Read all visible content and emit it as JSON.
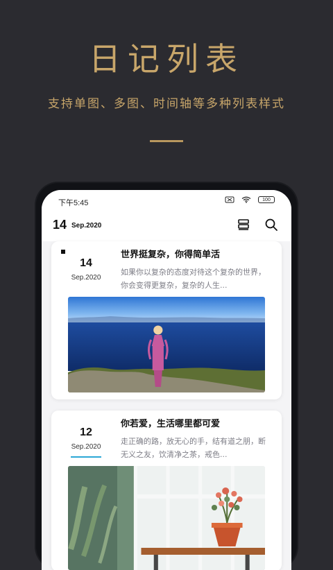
{
  "hero": {
    "title": "日记列表",
    "subtitle": "支持单图、多图、时间轴等多种列表样式"
  },
  "status_bar": {
    "time": "下午5:45",
    "battery": "100",
    "icons": [
      "sim-off-icon",
      "wifi-icon",
      "battery-icon"
    ]
  },
  "header": {
    "day": "14",
    "month_year": "Sep.2020",
    "icons": [
      "layout-icon",
      "search-icon"
    ]
  },
  "entries": [
    {
      "day": "14",
      "month_year": "Sep.2020",
      "title": "世界挺复杂，你得简单活",
      "excerpt": "如果你以复杂的态度对待这个复杂的世界，你会变得更复杂，复杂的人生...",
      "image": "lakeside-woman-image"
    },
    {
      "day": "12",
      "month_year": "Sep.2020",
      "title": "你若爱，生活哪里都可爱",
      "excerpt": "走正确的路，放无心的手，结有道之朋，断无义之友，饮清净之茶，戒色...",
      "image": "potted-plant-window-image",
      "accent_color": "#2aa7d6"
    }
  ],
  "colors": {
    "background": "#2b2b30",
    "gold": "#c8a66a",
    "accent": "#2aa7d6"
  }
}
